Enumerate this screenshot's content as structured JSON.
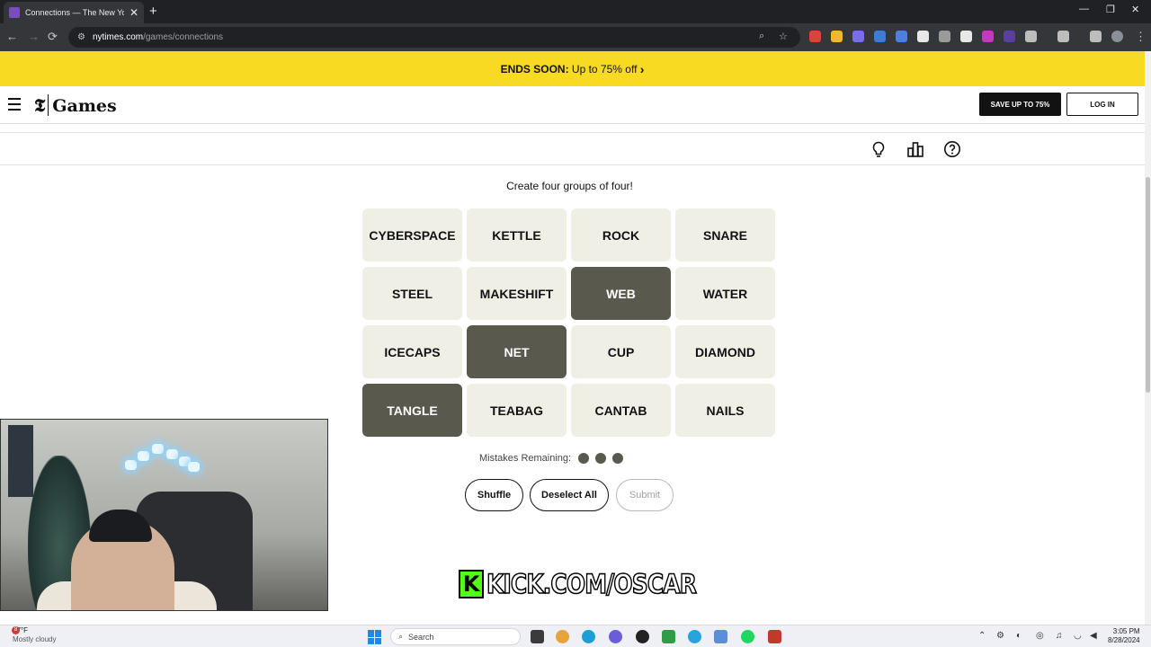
{
  "browser": {
    "tab_title": "Connections — The New York T",
    "url_host": "nytimes.com",
    "url_path": "/games/connections"
  },
  "promo": {
    "bold": "ENDS SOON:",
    "text": " Up to 75% off ",
    "chevron": "›"
  },
  "header": {
    "logo_mark": "𝕿",
    "logo_text": "Games",
    "save_label": "SAVE UP TO 75%",
    "login_label": "LOG IN"
  },
  "toolbar": {
    "icons": [
      "lightbulb-icon",
      "leaderboard-icon",
      "help-icon"
    ]
  },
  "game": {
    "instructions": "Create four groups of four!",
    "cards": [
      {
        "word": "CYBERSPACE",
        "selected": false
      },
      {
        "word": "KETTLE",
        "selected": false
      },
      {
        "word": "ROCK",
        "selected": false
      },
      {
        "word": "SNARE",
        "selected": false
      },
      {
        "word": "STEEL",
        "selected": false
      },
      {
        "word": "MAKESHIFT",
        "selected": false
      },
      {
        "word": "WEB",
        "selected": true
      },
      {
        "word": "WATER",
        "selected": false
      },
      {
        "word": "ICECAPS",
        "selected": false
      },
      {
        "word": "NET",
        "selected": true
      },
      {
        "word": "CUP",
        "selected": false
      },
      {
        "word": "DIAMOND",
        "selected": false
      },
      {
        "word": "TANGLE",
        "selected": true
      },
      {
        "word": "TEABAG",
        "selected": false
      },
      {
        "word": "CANTAB",
        "selected": false
      },
      {
        "word": "NAILS",
        "selected": false
      }
    ],
    "mistakes_label": "Mistakes Remaining:",
    "mistakes_remaining": 3,
    "shuffle_label": "Shuffle",
    "deselect_label": "Deselect All",
    "submit_label": "Submit"
  },
  "overlay": {
    "kick_logo": "K",
    "kick_text": "KICK.COM/OSCAR"
  },
  "taskbar": {
    "weather_temp": "87°F",
    "weather_desc": "Mostly cloudy",
    "weather_badge": "8",
    "search_placeholder": "Search",
    "time": "3:05 PM",
    "date": "8/28/2024"
  },
  "colors": {
    "card_bg": "#efefe6",
    "card_selected_bg": "#5a594e",
    "promo_bg": "#f7da21",
    "kick_green": "#53fc18"
  }
}
